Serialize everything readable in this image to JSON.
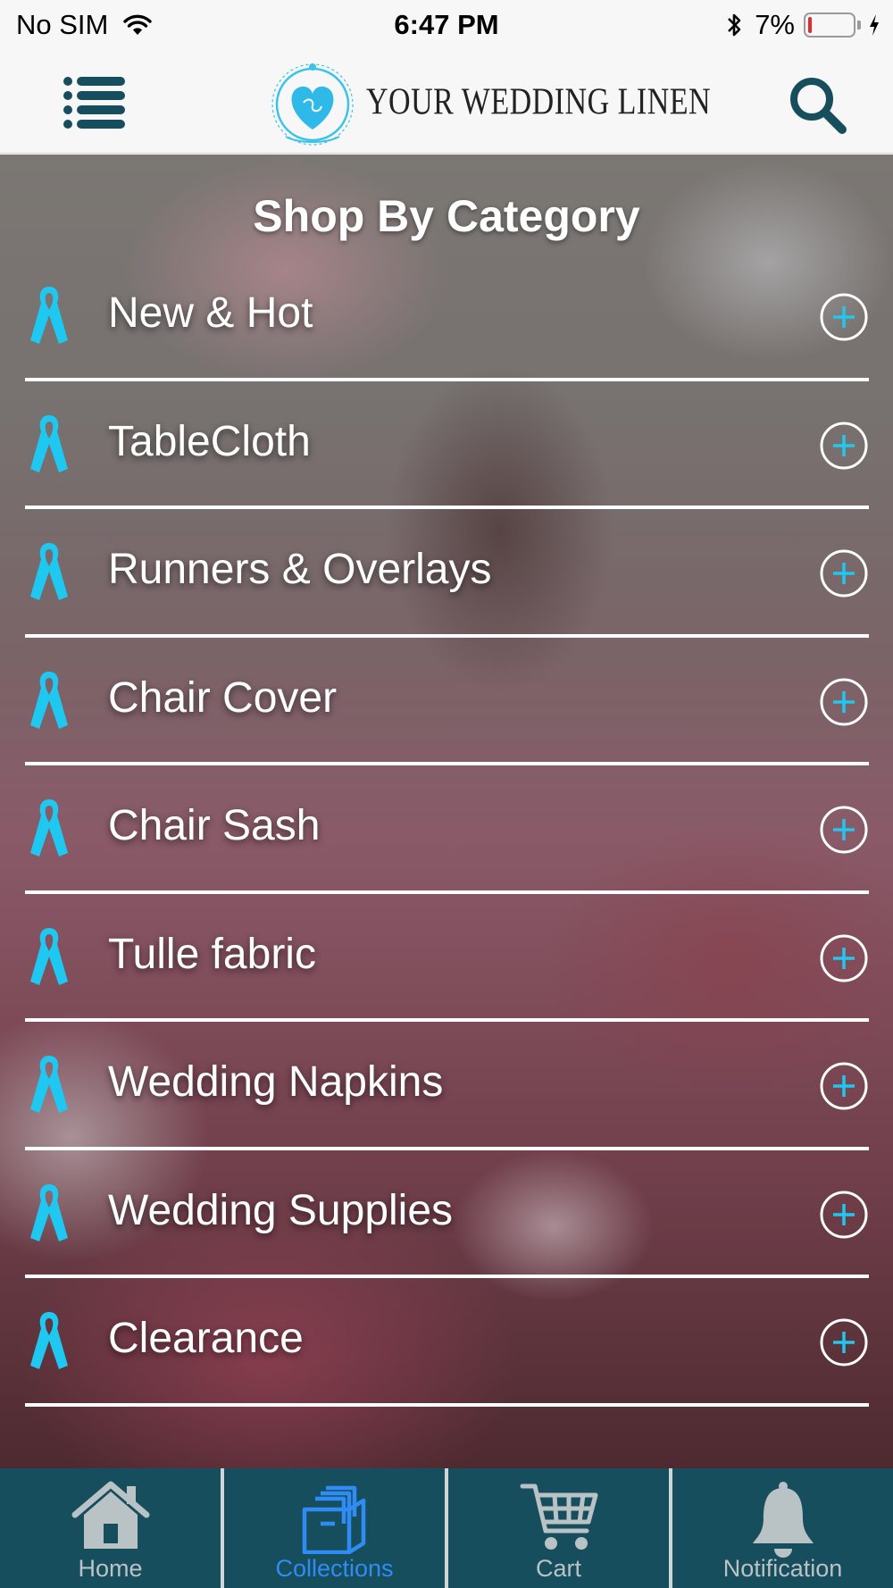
{
  "status_bar": {
    "carrier": "No SIM",
    "time": "6:47 PM",
    "battery_percent": "7%",
    "battery_level": 0.07
  },
  "header": {
    "logo_text": "YOUR WEDDING LINEN",
    "menu_icon": "menu-icon",
    "search_icon": "search-icon"
  },
  "main": {
    "section_title": "Shop By Category",
    "categories": [
      {
        "label": "New & Hot"
      },
      {
        "label": "TableCloth"
      },
      {
        "label": "Runners & Overlays"
      },
      {
        "label": "Chair Cover"
      },
      {
        "label": "Chair Sash"
      },
      {
        "label": "Tulle fabric"
      },
      {
        "label": "Wedding Napkins"
      },
      {
        "label": "Wedding Supplies"
      },
      {
        "label": "Clearance"
      }
    ],
    "category_icon": "ribbon-icon",
    "expand_icon": "plus-circle-icon"
  },
  "tab_bar": {
    "tabs": [
      {
        "label": "Home",
        "icon": "home-icon",
        "active": false
      },
      {
        "label": "Collections",
        "icon": "collections-icon",
        "active": true
      },
      {
        "label": "Cart",
        "icon": "cart-icon",
        "active": false
      },
      {
        "label": "Notification",
        "icon": "bell-icon",
        "active": false
      }
    ]
  },
  "colors": {
    "accent": "#1ec8f0",
    "tab_bar_bg": "#174e5e",
    "tab_active": "#2f8cf5",
    "tab_inactive": "#b9c2c5",
    "header_bg": "#f7f7f7",
    "header_icon": "#174e5e"
  }
}
